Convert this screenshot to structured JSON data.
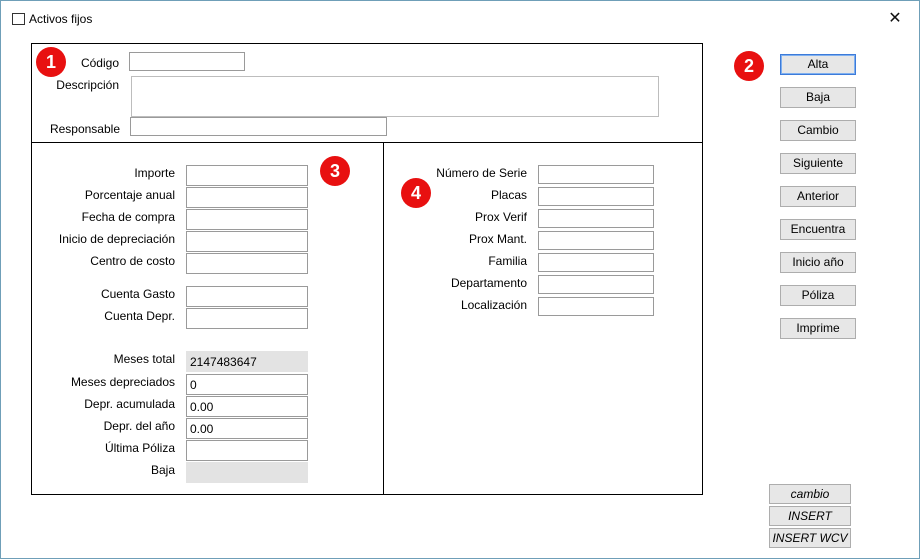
{
  "window": {
    "title": "Activos fijos",
    "close_glyph": "✕"
  },
  "badges": {
    "b1": "1",
    "b2": "2",
    "b3": "3",
    "b4": "4"
  },
  "header": {
    "codigo_label": "Código",
    "codigo_value": "",
    "descripcion_label": "Descripción",
    "descripcion_value": "",
    "responsable_label": "Responsable",
    "responsable_value": ""
  },
  "left": {
    "importe_label": "Importe",
    "porcentaje_label": "Porcentaje anual",
    "fecha_compra_label": "Fecha de compra",
    "inicio_depreciacion_label": "Inicio de depreciación",
    "centro_costo_label": "Centro de costo",
    "cuenta_gasto_label": "Cuenta Gasto",
    "cuenta_depr_label": "Cuenta Depr.",
    "meses_total_label": "Meses total",
    "meses_total_value": "2147483647",
    "meses_depreciados_label": "Meses depreciados",
    "meses_depreciados_value": "0",
    "depr_acumulada_label": "Depr. acumulada",
    "depr_acumulada_value": "0.00",
    "depr_anio_label": "Depr. del año",
    "depr_anio_value": "0.00",
    "ultima_poliza_label": "Última Póliza",
    "ultima_poliza_value": "",
    "baja_label": "Baja",
    "baja_value": ""
  },
  "right": {
    "numero_serie_label": "Número de Serie",
    "placas_label": "Placas",
    "prox_verif_label": "Prox Verif",
    "prox_mant_label": "Prox Mant.",
    "familia_label": "Familia",
    "departamento_label": "Departamento",
    "localizacion_label": "Localización"
  },
  "buttons": {
    "alta": "Alta",
    "baja": "Baja",
    "cambio": "Cambio",
    "siguiente": "Siguiente",
    "anterior": "Anterior",
    "encuentra": "Encuentra",
    "inicio_anio": "Inicio año",
    "poliza": "Póliza",
    "imprime": "Imprime"
  },
  "status_buttons": {
    "cambio": "cambio",
    "insert": "INSERT",
    "insert_wcv": "INSERT WCV"
  },
  "colors": {
    "badge": "#e81010",
    "default_button_border": "#3d7bd9",
    "readonly_field": "#e3e3e3"
  }
}
